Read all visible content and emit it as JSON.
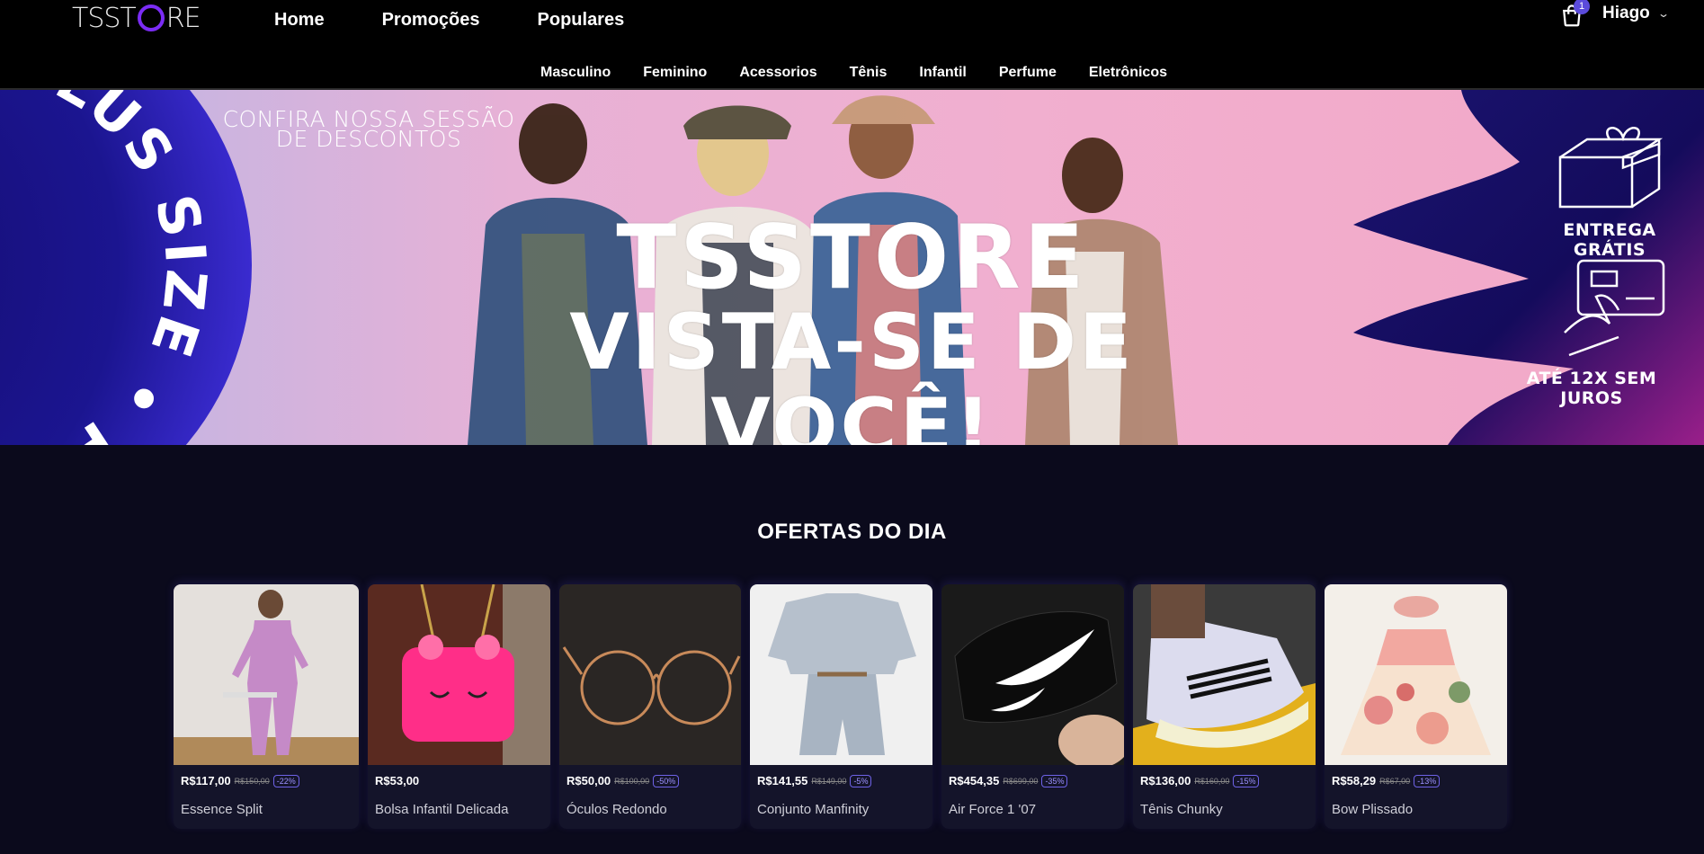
{
  "header": {
    "logo": "TSST RE",
    "nav": [
      "Home",
      "Promoções",
      "Populares"
    ],
    "cart_count": "1",
    "user_name": "Hiago",
    "categories": [
      "Masculino",
      "Feminino",
      "Acessorios",
      "Tênis",
      "Infantil",
      "Perfume",
      "Eletrônicos"
    ]
  },
  "banner": {
    "side_text": "PLUS SIZE • PLUS SIZE",
    "promo_line1": "CONFIRA NOSSA SESSÃO",
    "promo_line2": "DE DESCONTOS",
    "brand": "TSSTORE",
    "tagline": "VISTA-SE DE VOCÊ!",
    "perk1": "ENTREGA GRÁTIS",
    "perk2": "ATÉ 12X SEM JUROS"
  },
  "offers": {
    "title": "OFERTAS DO DIA",
    "items": [
      {
        "name": "Essence Split",
        "price": "R$117,00",
        "old_price": "R$150,00",
        "discount": "-22%"
      },
      {
        "name": "Bolsa Infantil Delicada",
        "price": "R$53,00",
        "old_price": "",
        "discount": ""
      },
      {
        "name": "Óculos Redondo",
        "price": "R$50,00",
        "old_price": "R$100,00",
        "discount": "-50%"
      },
      {
        "name": "Conjunto Manfinity",
        "price": "R$141,55",
        "old_price": "R$149,00",
        "discount": "-5%"
      },
      {
        "name": "Air Force 1 '07",
        "price": "R$454,35",
        "old_price": "R$699,00",
        "discount": "-35%"
      },
      {
        "name": "Tênis Chunky",
        "price": "R$136,00",
        "old_price": "R$160,00",
        "discount": "-15%"
      },
      {
        "name": "Bow Plissado",
        "price": "R$58,29",
        "old_price": "R$67,00",
        "discount": "-13%"
      }
    ]
  },
  "colors": {
    "accent": "#7b2cf5",
    "badge": "#5b4bdb",
    "background": "#0b0a1c"
  }
}
